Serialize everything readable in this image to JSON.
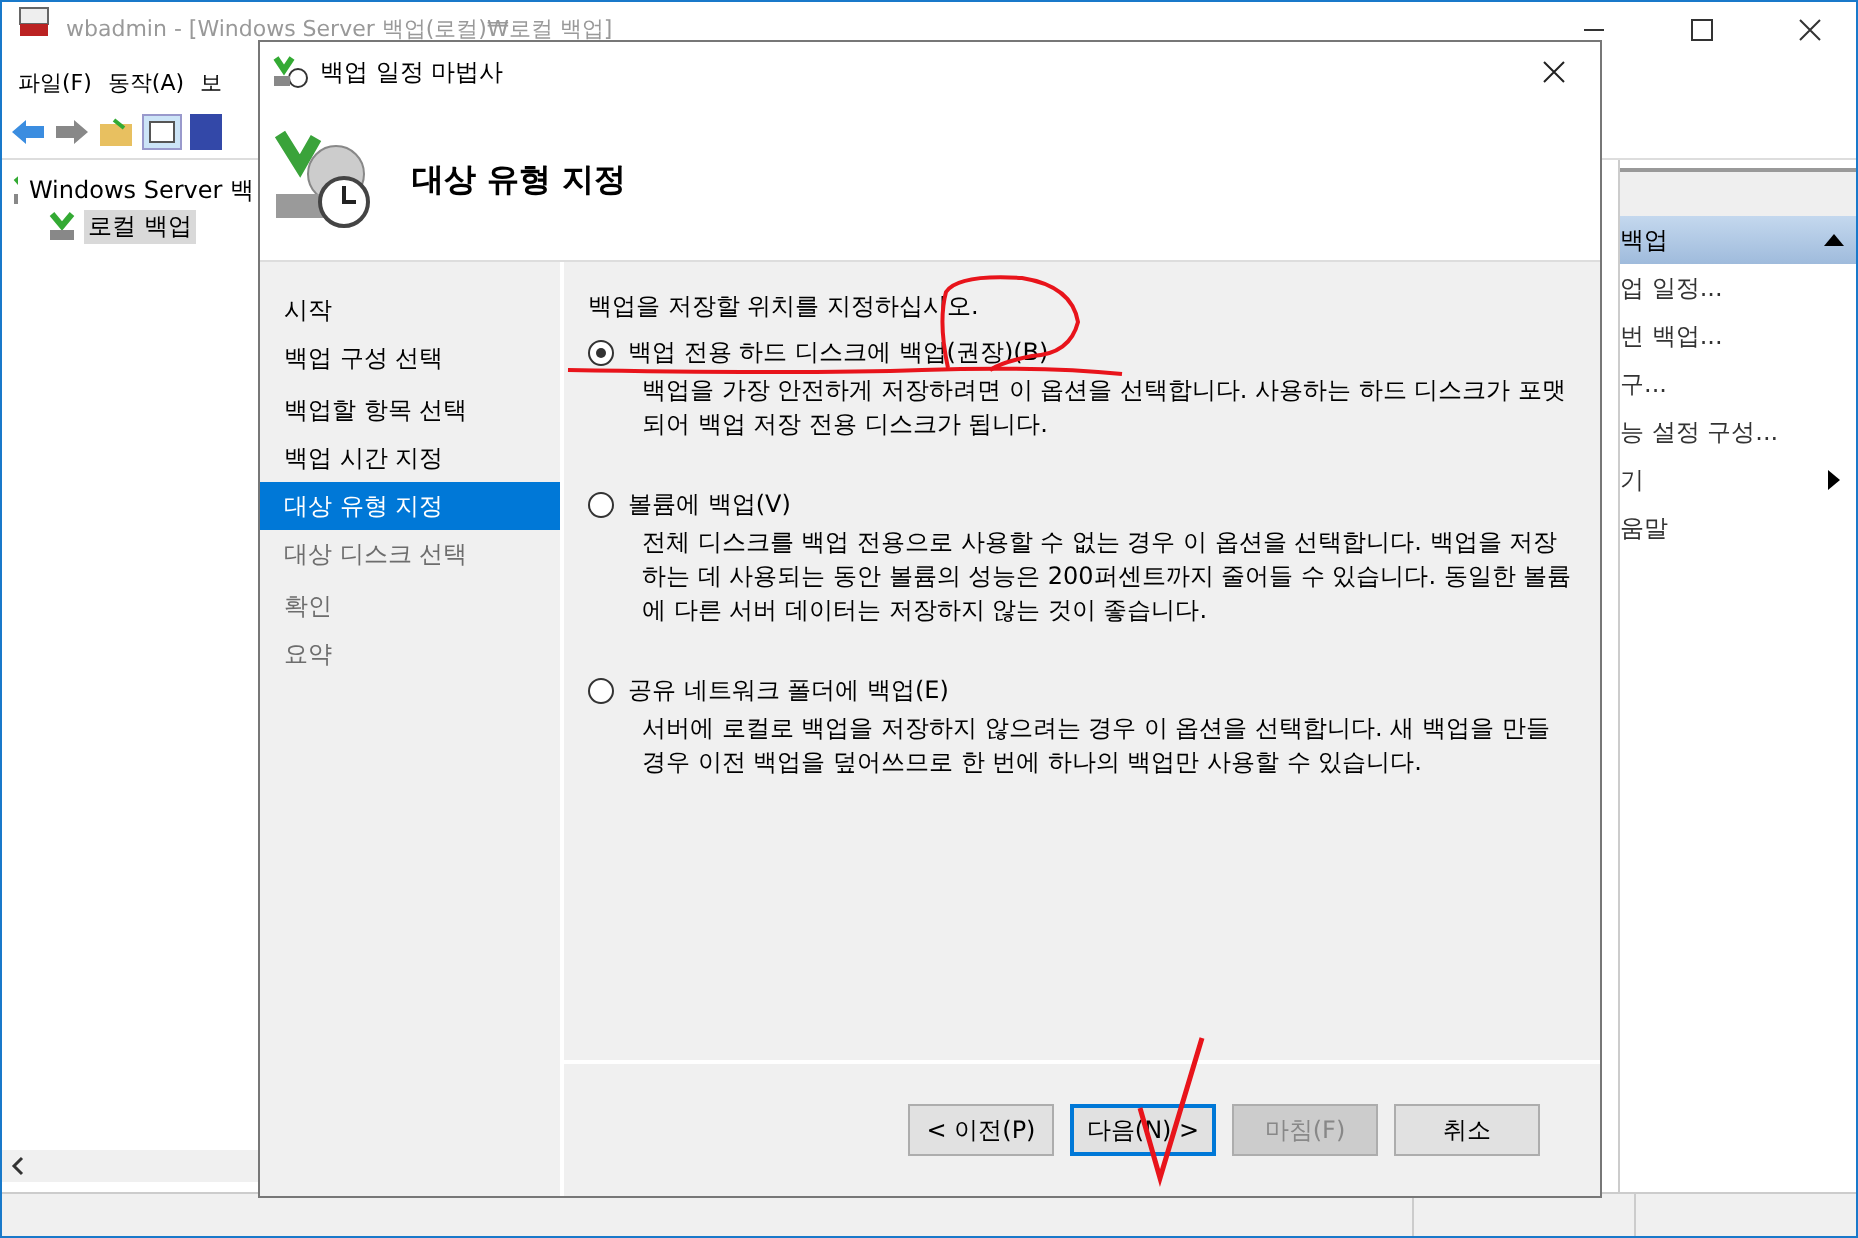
{
  "main_window": {
    "title": "wbadmin - [Windows Server 백업(로컬)₩로컬 백업]",
    "menus": [
      "파일(F)",
      "동작(A)",
      "보"
    ],
    "tree": {
      "label": "Windows Server 백",
      "children": [
        {
          "label": "로컬 백업",
          "selected": true
        }
      ]
    },
    "actions": {
      "header": "백업",
      "items": [
        {
          "label": "업 일정...",
          "submenu": false
        },
        {
          "label": "번 백업...",
          "submenu": false
        },
        {
          "label": "구...",
          "submenu": false
        },
        {
          "label": "능 설정 구성...",
          "submenu": false
        },
        {
          "label": "기",
          "submenu": true
        },
        {
          "label": "움말",
          "submenu": false
        }
      ]
    }
  },
  "dialog": {
    "title": "백업 일정 마법사",
    "heading": "대상 유형 지정",
    "steps": [
      {
        "label": "시작",
        "selected": false,
        "disabled": false
      },
      {
        "label": "백업 구성 선택",
        "selected": false,
        "disabled": false
      },
      {
        "label": "백업할 항목 선택",
        "selected": false,
        "disabled": false
      },
      {
        "label": "백업 시간 지정",
        "selected": false,
        "disabled": false
      },
      {
        "label": "대상 유형 지정",
        "selected": true,
        "disabled": false
      },
      {
        "label": "대상 디스크 선택",
        "selected": false,
        "disabled": true
      },
      {
        "label": "확인",
        "selected": false,
        "disabled": true
      },
      {
        "label": "요약",
        "selected": false,
        "disabled": true
      }
    ],
    "instruction": "백업을 저장할 위치를 지정하십시오.",
    "options": [
      {
        "label": "백업 전용 하드 디스크에 백업(권장)(B)",
        "selected": true,
        "description": "백업을 가장 안전하게 저장하려면 이 옵션을 선택합니다. 사용하는 하드 디스크가 포맷되어 백업 저장 전용 디스크가 됩니다."
      },
      {
        "label": "볼륨에 백업(V)",
        "selected": false,
        "description": "전체 디스크를 백업 전용으로 사용할 수 없는 경우 이 옵션을 선택합니다. 백업을 저장하는 데 사용되는 동안 볼륨의 성능은 200퍼센트까지 줄어들 수 있습니다. 동일한 볼륨에 다른 서버 데이터는 저장하지 않는 것이 좋습니다."
      },
      {
        "label": "공유 네트워크 폴더에 백업(E)",
        "selected": false,
        "description": "서버에 로컬로 백업을 저장하지 않으려는 경우 이 옵션을 선택합니다. 새 백업을 만들 경우 이전 백업을 덮어쓰므로 한 번에 하나의 백업만 사용할 수 있습니다."
      }
    ],
    "buttons": [
      {
        "label": "< 이전(P)",
        "disabled": false,
        "focused": false
      },
      {
        "label": "다음(N) >",
        "disabled": false,
        "focused": true
      },
      {
        "label": "마침(F)",
        "disabled": true,
        "focused": false
      },
      {
        "label": "취소",
        "disabled": false,
        "focused": false
      }
    ]
  }
}
